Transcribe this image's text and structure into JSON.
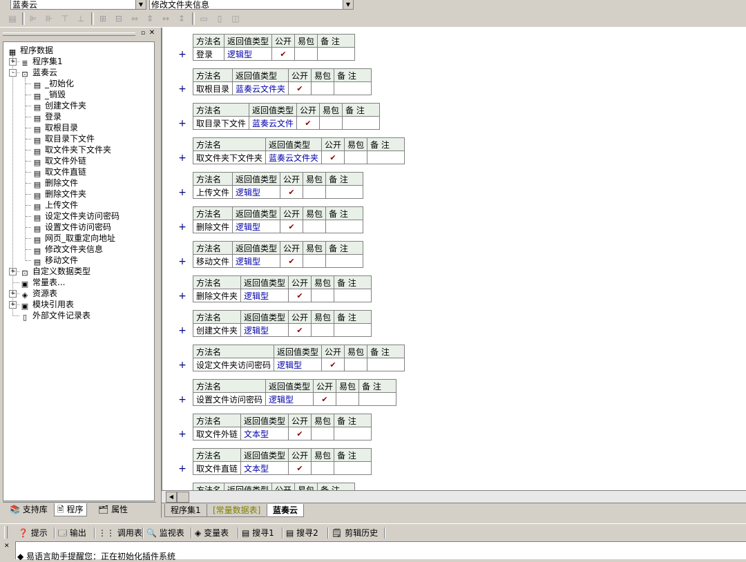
{
  "top": {
    "left_combo": "蓝奏云",
    "right_combo": "修改文件夹信息"
  },
  "tree": {
    "root": "程序数据",
    "items": [
      {
        "label": "程序集1",
        "level": 1,
        "icon": "assembly-icon"
      },
      {
        "label": "蓝奏云",
        "level": 1,
        "icon": "class-icon"
      },
      {
        "label": "_初始化",
        "level": 2,
        "icon": "method-icon"
      },
      {
        "label": "_销毁",
        "level": 2,
        "icon": "method-icon"
      },
      {
        "label": "创建文件夹",
        "level": 2,
        "icon": "method-icon"
      },
      {
        "label": "登录",
        "level": 2,
        "icon": "method-icon"
      },
      {
        "label": "取根目录",
        "level": 2,
        "icon": "method-icon"
      },
      {
        "label": "取目录下文件",
        "level": 2,
        "icon": "method-icon"
      },
      {
        "label": "取文件夹下文件夹",
        "level": 2,
        "icon": "method-icon"
      },
      {
        "label": "取文件外链",
        "level": 2,
        "icon": "method-icon"
      },
      {
        "label": "取文件直链",
        "level": 2,
        "icon": "method-icon"
      },
      {
        "label": "删除文件",
        "level": 2,
        "icon": "method-icon"
      },
      {
        "label": "删除文件夹",
        "level": 2,
        "icon": "method-icon"
      },
      {
        "label": "上传文件",
        "level": 2,
        "icon": "method-icon"
      },
      {
        "label": "设定文件夹访问密码",
        "level": 2,
        "icon": "method-icon"
      },
      {
        "label": "设置文件访问密码",
        "level": 2,
        "icon": "method-icon"
      },
      {
        "label": "网页_取重定向地址",
        "level": 2,
        "icon": "method-icon"
      },
      {
        "label": "修改文件夹信息",
        "level": 2,
        "icon": "method-icon"
      },
      {
        "label": "移动文件",
        "level": 2,
        "icon": "method-icon"
      },
      {
        "label": "自定义数据类型",
        "level": 1,
        "icon": "datatype-icon"
      },
      {
        "label": "常量表...",
        "level": 1,
        "icon": "constant-icon"
      },
      {
        "label": "资源表",
        "level": 1,
        "icon": "resource-icon"
      },
      {
        "label": "模块引用表",
        "level": 1,
        "icon": "module-icon"
      },
      {
        "label": "外部文件记录表",
        "level": 1,
        "icon": "file-icon"
      }
    ]
  },
  "left_tabs": [
    "支持库",
    "程序",
    "属性"
  ],
  "table_headers": {
    "method": "方法名",
    "return_type": "返回值类型",
    "public": "公开",
    "easy_pack": "易包",
    "note": "备 注"
  },
  "methods": [
    {
      "name": "登录",
      "type": "逻辑型",
      "public": "✔"
    },
    {
      "name": "取根目录",
      "type": "蓝奏云文件夹",
      "public": "✔"
    },
    {
      "name": "取目录下文件",
      "type": "蓝奏云文件",
      "public": "✔"
    },
    {
      "name": "取文件夹下文件夹",
      "type": "蓝奏云文件夹",
      "public": "✔"
    },
    {
      "name": "上传文件",
      "type": "逻辑型",
      "public": "✔"
    },
    {
      "name": "删除文件",
      "type": "逻辑型",
      "public": "✔"
    },
    {
      "name": "移动文件",
      "type": "逻辑型",
      "public": "✔"
    },
    {
      "name": "删除文件夹",
      "type": "逻辑型",
      "public": "✔"
    },
    {
      "name": "创建文件夹",
      "type": "逻辑型",
      "public": "✔"
    },
    {
      "name": "设定文件夹访问密码",
      "type": "逻辑型",
      "public": "✔"
    },
    {
      "name": "设置文件访问密码",
      "type": "逻辑型",
      "public": "✔"
    },
    {
      "name": "取文件外链",
      "type": "文本型",
      "public": "✔"
    },
    {
      "name": "取文件直链",
      "type": "文本型",
      "public": "✔"
    },
    {
      "name": "",
      "type": "",
      "public": ""
    }
  ],
  "file_tabs": [
    "程序集1",
    "[常量数据表]",
    "蓝奏云"
  ],
  "output_toolbar": [
    "提示",
    "输出",
    "调用表",
    "监视表",
    "变量表",
    "搜寻1",
    "搜寻2",
    "剪辑历史"
  ],
  "status_message": "◆ 易语言助手提醒您：正在初始化插件系统"
}
